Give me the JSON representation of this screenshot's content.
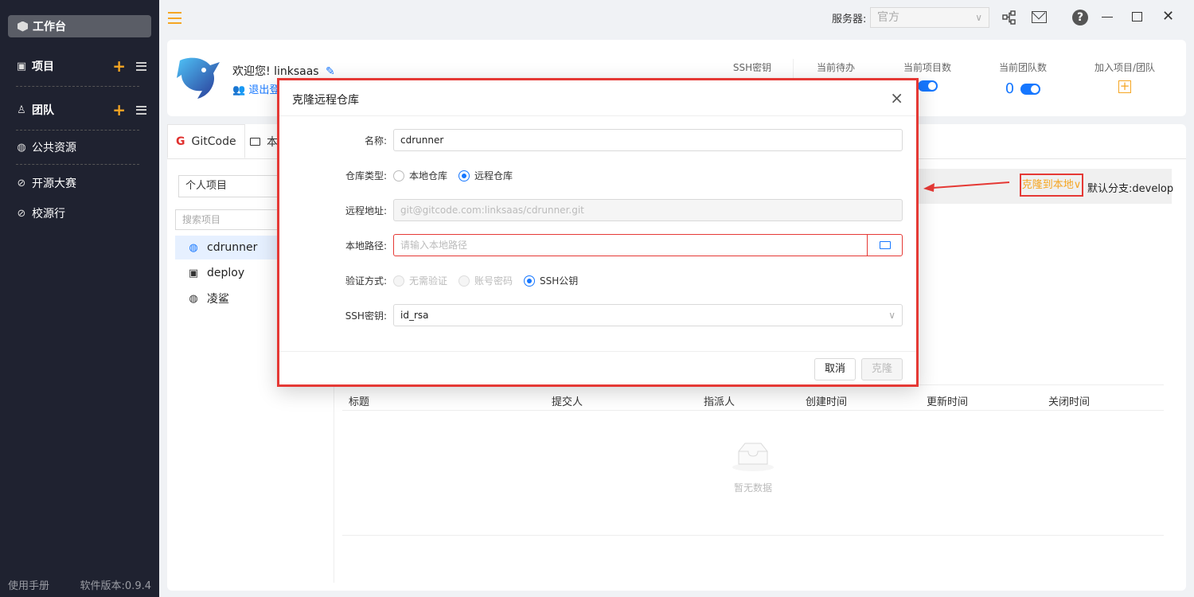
{
  "sidebar": {
    "workspace": "工作台",
    "project": "项目",
    "team": "团队",
    "public_resources": "公共资源",
    "open_source_contest": "开源大赛",
    "campus_tour": "校源行",
    "manual": "使用手册",
    "version": "软件版本:0.9.4"
  },
  "topbar": {
    "server_label": "服务器:",
    "server_value": "官方"
  },
  "welcome": {
    "greeting": "欢迎您!",
    "username": "linksaas",
    "logout": "退出登",
    "stats": {
      "ssh_key": "SSH密钥",
      "todo": "当前待办",
      "project_count": "当前项目数",
      "team_count": "当前团队数",
      "team_count_value": "0",
      "join": "加入项目/团队"
    }
  },
  "main": {
    "tabs": [
      "GitCode",
      "本"
    ],
    "project_filter": "个人项目",
    "search_placeholder": "搜索项目",
    "projects": [
      "cdrunner",
      "deploy",
      "凌鲨"
    ],
    "clone_local": "克隆到本地",
    "default_branch": "默认分支:develop",
    "issue_columns": [
      "标题",
      "提交人",
      "指派人",
      "创建时间",
      "更新时间",
      "关闭时间"
    ],
    "empty_text": "暂无数据"
  },
  "modal": {
    "title": "克隆远程仓库",
    "name_label": "名称:",
    "name_value": "cdrunner",
    "repo_type_label": "仓库类型:",
    "repo_type_options": [
      "本地仓库",
      "远程仓库"
    ],
    "remote_url_label": "远程地址:",
    "remote_url_value": "git@gitcode.com:linksaas/cdrunner.git",
    "local_path_label": "本地路径:",
    "local_path_placeholder": "请输入本地路径",
    "auth_label": "验证方式:",
    "auth_options": [
      "无需验证",
      "账号密码",
      "SSH公钥"
    ],
    "ssh_key_label": "SSH密钥:",
    "ssh_key_value": "id_rsa",
    "cancel": "取消",
    "clone": "克隆"
  }
}
